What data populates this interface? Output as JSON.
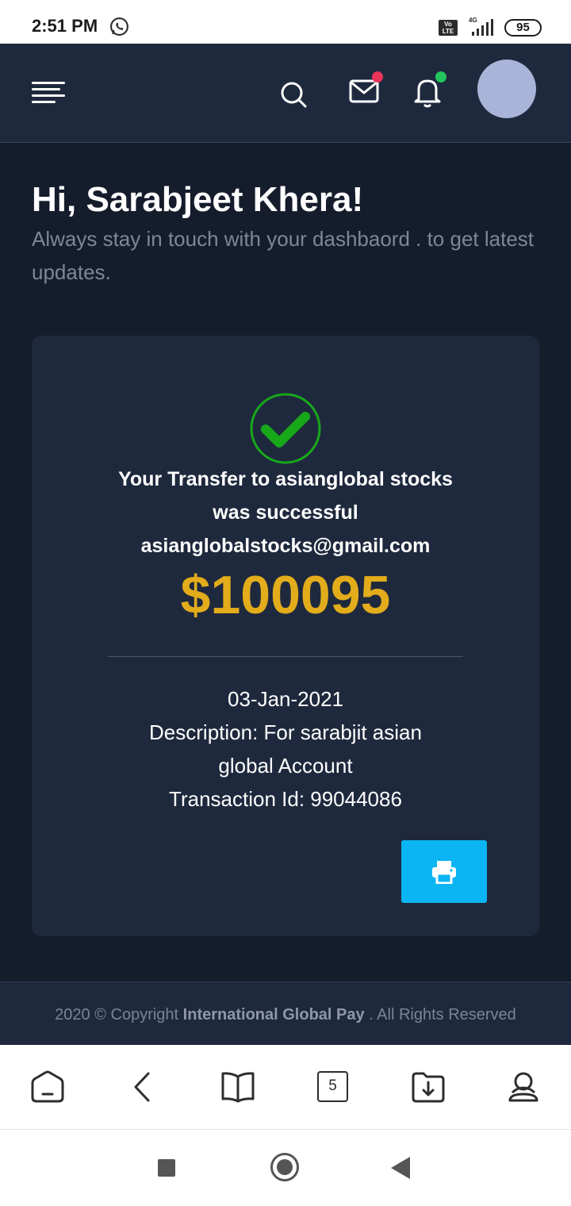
{
  "status_bar": {
    "time": "2:51 PM",
    "network_badge": "Vo LTE",
    "network_type": "4G",
    "battery": "95",
    "notification_icon": "whatsapp-icon"
  },
  "header": {
    "menu_icon": "hamburger-menu-icon",
    "search_icon": "search-icon",
    "mail_icon": "mail-icon",
    "bell_icon": "bell-icon",
    "mail_dot_color": "#e8345a",
    "bell_dot_color": "#22c55e"
  },
  "greeting": {
    "title": "Hi, Sarabjeet Khera!",
    "subtitle": "Always stay in touch with your dashbaord . to get latest updates."
  },
  "transfer": {
    "message_line1": "Your Transfer to asianglobal stocks",
    "message_line2": "was successful",
    "email": "asianglobalstocks@gmail.com",
    "amount": "$100095",
    "date": "03-Jan-2021",
    "description_line1": "Description: For sarabjit asian",
    "description_line2": "global Account",
    "transaction_id": "Transaction Id: 99044086",
    "print_icon": "print-icon",
    "success_color": "#17a81a",
    "amount_color": "#e3ac1b",
    "print_button_color": "#0bb4f2"
  },
  "footer": {
    "prefix": "2020 © Copyright ",
    "brand": "International Global Pay",
    "suffix": " . All Rights Reserved"
  },
  "browser_bar": {
    "tab_count": "5",
    "icons": [
      "home-icon",
      "back-arrow-icon",
      "bookmarks-book-icon",
      "tabs-icon",
      "downloads-icon",
      "profile-icon"
    ]
  },
  "nav_bar": {
    "icons": [
      "recents-square-icon",
      "home-circle-icon",
      "back-triangle-icon"
    ]
  }
}
